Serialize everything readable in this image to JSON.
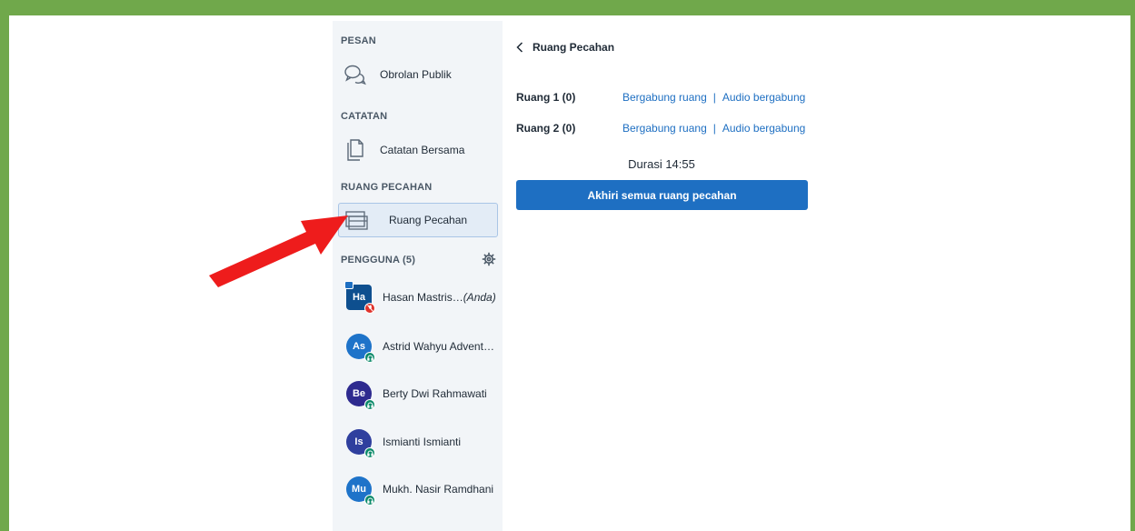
{
  "colors": {
    "frame": "#70a84b",
    "sidebar_bg": "#f2f5f8",
    "accent": "#1e6fc2",
    "arrow": "#ee1c1c"
  },
  "sidebar": {
    "messages_section": "PESAN",
    "public_chat": {
      "label": "Obrolan Publik",
      "icon": "chat-bubbles-icon"
    },
    "notes_section": "CATATAN",
    "shared_notes": {
      "label": "Catatan Bersama",
      "icon": "document-icon"
    },
    "breakout_section": "RUANG PECAHAN",
    "breakout_rooms": {
      "label": "Ruang Pecahan",
      "icon": "breakout-rooms-icon"
    },
    "users_section": "PENGGUNA (5)",
    "users": [
      {
        "initials": "Ha",
        "name": "Hasan Mastris…",
        "suffix": "(Anda)",
        "avatar_color": "#0e4f8f",
        "status": "muted",
        "presenter": true
      },
      {
        "initials": "As",
        "name": "Astrid Wahyu Advent…",
        "suffix": "",
        "avatar_color": "#1e73c9",
        "status": "audio",
        "presenter": false
      },
      {
        "initials": "Be",
        "name": "Berty Dwi Rahmawati",
        "suffix": "",
        "avatar_color": "#2e2a8f",
        "status": "audio",
        "presenter": false
      },
      {
        "initials": "Is",
        "name": "Ismianti Ismianti",
        "suffix": "",
        "avatar_color": "#2f3f9e",
        "status": "audio",
        "presenter": false
      },
      {
        "initials": "Mu",
        "name": "Mukh. Nasir Ramdhani",
        "suffix": "",
        "avatar_color": "#1e73c9",
        "status": "audio",
        "presenter": false
      }
    ]
  },
  "panel": {
    "back_label": "Ruang Pecahan",
    "rooms": [
      {
        "name": "Ruang 1 (0)",
        "join_label": "Bergabung ruang",
        "separator": "|",
        "audio_label": "Audio bergabung"
      },
      {
        "name": "Ruang 2 (0)",
        "join_label": "Bergabung ruang",
        "separator": "|",
        "audio_label": "Audio bergabung"
      }
    ],
    "duration": "Durasi 14:55",
    "end_button": "Akhiri semua ruang pecahan"
  }
}
